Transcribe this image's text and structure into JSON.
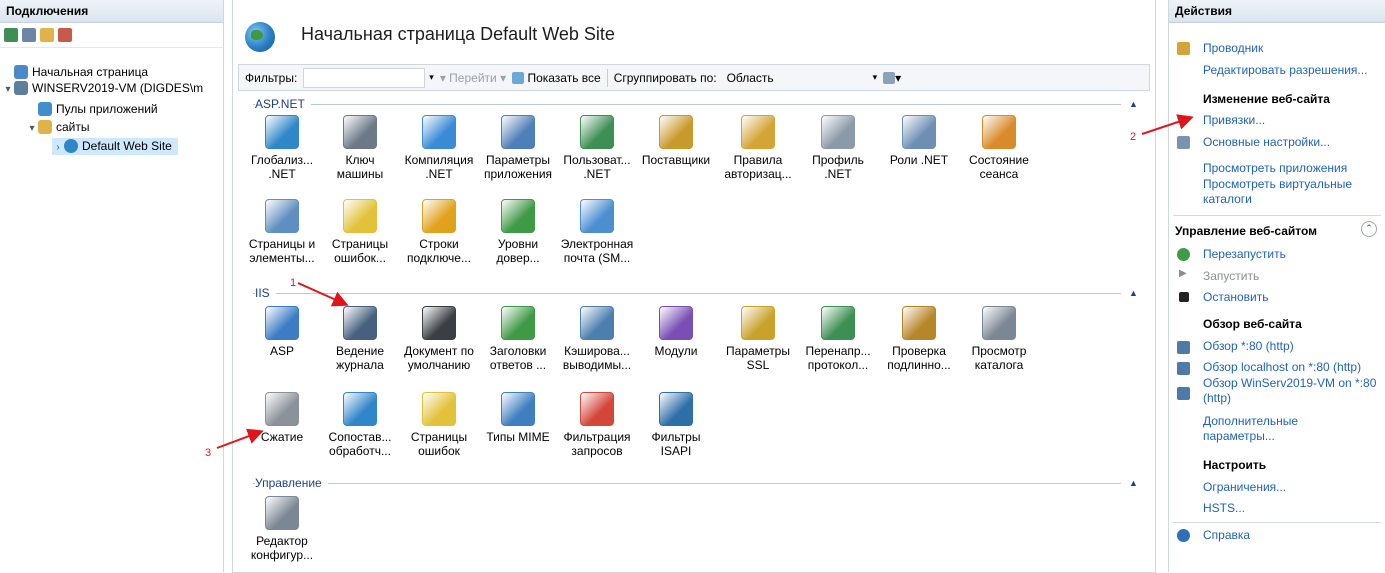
{
  "left_panel": {
    "title": "Подключения",
    "tree": [
      {
        "label": "Начальная страница"
      },
      {
        "label": "WINSERV2019-VM (DIGDES\\m"
      },
      {
        "label": "Пулы приложений"
      },
      {
        "label": "сайты"
      },
      {
        "label": "Default Web Site"
      }
    ]
  },
  "main": {
    "title": "Начальная страница Default Web Site",
    "filterbar": {
      "filters_label": "Фильтры:",
      "go_label": "Перейти",
      "show_all_label": "Показать все",
      "group_by_label": "Сгруппировать по:",
      "group_by_value": "Область"
    },
    "groups": [
      {
        "name": "ASP.NET",
        "items": [
          {
            "label": "Глобализ... .NET",
            "icon": "globe-icon",
            "color": "#2f86c9"
          },
          {
            "label": "Ключ машины",
            "icon": "key-server-icon",
            "color": "#6c7a88"
          },
          {
            "label": "Компиляция .NET",
            "icon": "compile-icon",
            "color": "#3a8bd6"
          },
          {
            "label": "Параметры приложения",
            "icon": "settings-list-icon",
            "color": "#4f7fb8"
          },
          {
            "label": "Пользоват... .NET",
            "icon": "users-icon",
            "color": "#3d8f55"
          },
          {
            "label": "Поставщики",
            "icon": "providers-icon",
            "color": "#c89a2c"
          },
          {
            "label": "Правила авторизац...",
            "icon": "auth-rules-icon",
            "color": "#d4a437"
          },
          {
            "label": "Профиль .NET",
            "icon": "profile-icon",
            "color": "#8a9aa8"
          },
          {
            "label": "Роли .NET",
            "icon": "roles-icon",
            "color": "#6d8fb3"
          },
          {
            "label": "Состояние сеанса",
            "icon": "session-icon",
            "color": "#d98a2b"
          },
          {
            "label": "Страницы и элементы...",
            "icon": "pages-controls-icon",
            "color": "#5f8fc0"
          },
          {
            "label": "Страницы ошибок...",
            "icon": "error-pages-icon",
            "color": "#e2c23a"
          },
          {
            "label": "Строки подключе...",
            "icon": "connection-strings-icon",
            "color": "#e0a21c"
          },
          {
            "label": "Уровни довер...",
            "icon": "trust-levels-icon",
            "color": "#3f9a46"
          },
          {
            "label": "Электронная почта (SM...",
            "icon": "email-icon",
            "color": "#4b8fd1"
          }
        ]
      },
      {
        "name": "IIS",
        "items": [
          {
            "label": "ASP",
            "icon": "asp-icon",
            "color": "#3b7cc5"
          },
          {
            "label": "Ведение журнала",
            "icon": "logging-icon",
            "color": "#46607e"
          },
          {
            "label": "Документ по умолчанию",
            "icon": "default-document-icon",
            "color": "#3a3f44"
          },
          {
            "label": "Заголовки ответов ...",
            "icon": "response-headers-icon",
            "color": "#3f9a46"
          },
          {
            "label": "Кэширова... выводимы...",
            "icon": "output-caching-icon",
            "color": "#4c7fb0"
          },
          {
            "label": "Модули",
            "icon": "modules-icon",
            "color": "#7a4fb5"
          },
          {
            "label": "Параметры SSL",
            "icon": "ssl-lock-icon",
            "color": "#c9a22c"
          },
          {
            "label": "Перенапр... протокол...",
            "icon": "redirect-icon",
            "color": "#3d8f55"
          },
          {
            "label": "Проверка подлинно...",
            "icon": "authentication-icon",
            "color": "#b8862a"
          },
          {
            "label": "Просмотр каталога",
            "icon": "directory-browsing-icon",
            "color": "#7b8794"
          },
          {
            "label": "Сжатие",
            "icon": "compression-icon",
            "color": "#8b9299"
          },
          {
            "label": "Сопостав... обработч...",
            "icon": "handler-mappings-icon",
            "color": "#2f86c9"
          },
          {
            "label": "Страницы ошибок",
            "icon": "error-pages-icon",
            "color": "#e2c23a"
          },
          {
            "label": "Типы MIME",
            "icon": "mime-types-icon",
            "color": "#3f7fc0"
          },
          {
            "label": "Фильтрация запросов",
            "icon": "request-filtering-icon",
            "color": "#d4463a"
          },
          {
            "label": "Фильтры ISAPI",
            "icon": "isapi-filters-icon",
            "color": "#2f6fa8"
          }
        ]
      },
      {
        "name": "Управление",
        "items": [
          {
            "label": "Редактор конфигур...",
            "icon": "config-editor-icon",
            "color": "#7b8794"
          }
        ]
      }
    ]
  },
  "right_panel": {
    "title": "Действия",
    "explore": "Проводник",
    "edit_permissions": "Редактировать разрешения...",
    "edit_site_header": "Изменение веб-сайта",
    "bindings": "Привязки...",
    "basic_settings": "Основные настройки...",
    "view_applications": "Просмотреть приложения",
    "view_virtual_dirs": "Просмотреть виртуальные каталоги",
    "manage_site_header": "Управление веб-сайтом",
    "restart": "Перезапустить",
    "start": "Запустить",
    "stop": "Остановить",
    "browse_header": "Обзор веб-сайта",
    "browse_80": "Обзор *:80 (http)",
    "browse_localhost": "Обзор localhost on *:80 (http)",
    "browse_winserv": "Обзор WinServ2019-VM on *:80 (http)",
    "advanced": "Дополнительные параметры...",
    "configure_header": "Настроить",
    "limits": "Ограничения...",
    "hsts": "HSTS...",
    "help": "Справка"
  },
  "annotations": [
    "1",
    "2",
    "3"
  ]
}
